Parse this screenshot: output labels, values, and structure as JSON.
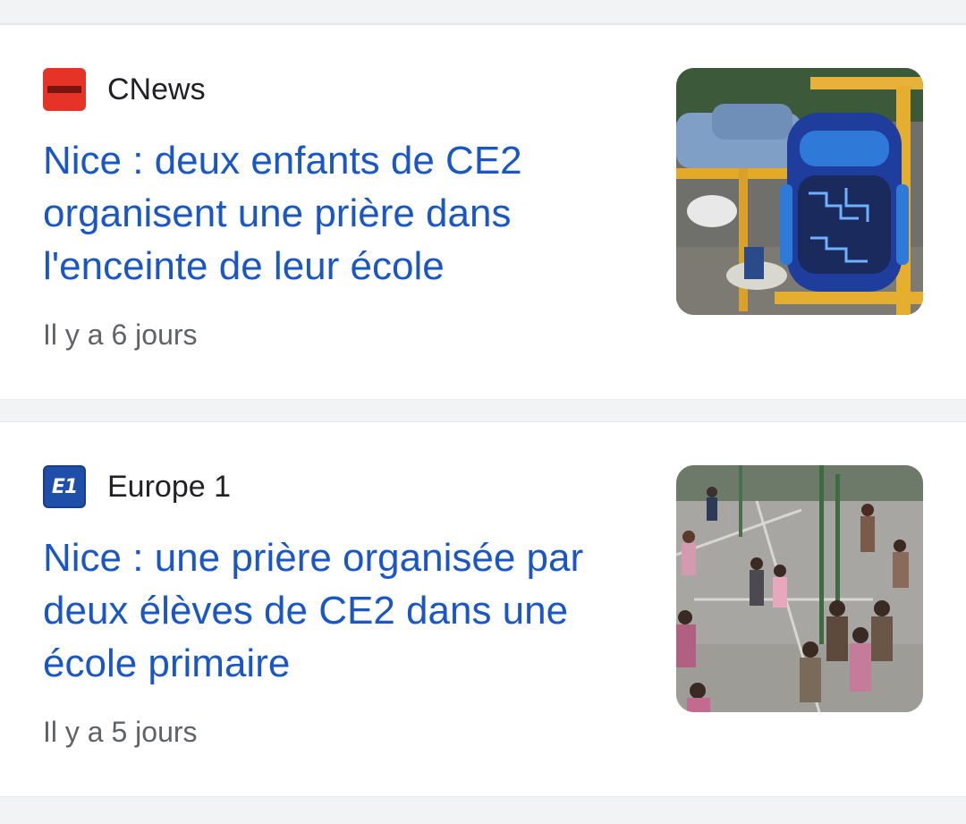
{
  "articles": [
    {
      "source": "CNews",
      "source_icon": "cnews-logo-icon",
      "source_color": "#e53327",
      "headline": "Nice : deux enfants de CE2 organisent une prière dans l'enceinte de leur école",
      "time": "Il y a 6 jours",
      "thumbnail": "schoolbag-under-desk-photo"
    },
    {
      "source": "Europe 1",
      "source_icon": "europe1-logo-icon",
      "source_logo_text": "E1",
      "source_color": "#1f4fa8",
      "headline": "Nice : une prière organisée par deux élèves de CE2 dans une école primaire",
      "time": "Il y a 5 jours",
      "thumbnail": "schoolyard-children-photo"
    }
  ],
  "colors": {
    "headline": "#1a57c5",
    "meta": "#5f6368",
    "background": "#f1f3f4",
    "card": "#ffffff"
  }
}
